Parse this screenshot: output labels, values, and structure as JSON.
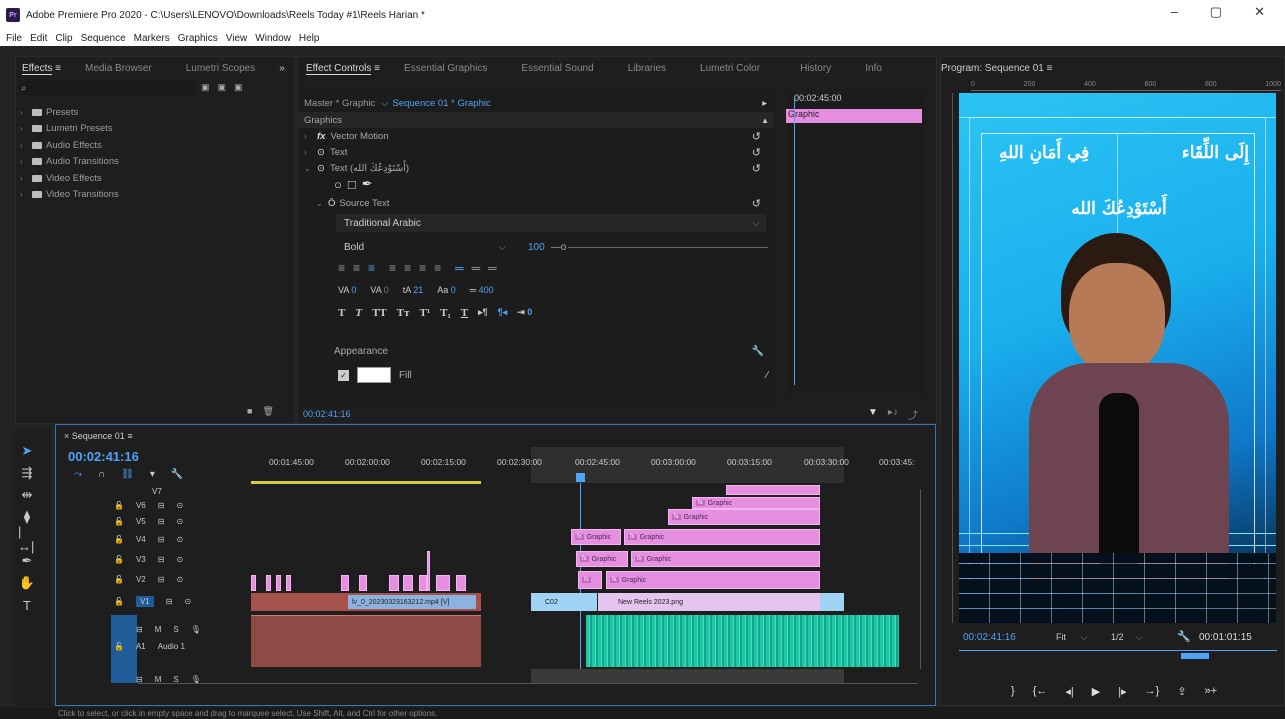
{
  "window": {
    "app_icon": "Pr",
    "title": "Adobe Premiere Pro 2020 - C:\\Users\\LENOVO\\Downloads\\Reels Today #1\\Reels Harian *",
    "controls": [
      "–",
      "▢",
      "✕"
    ]
  },
  "menu": [
    "File",
    "Edit",
    "Clip",
    "Sequence",
    "Markers",
    "Graphics",
    "View",
    "Window",
    "Help"
  ],
  "effects_panel": {
    "tabs": [
      "Effects",
      "Media Browser",
      "Lumetri Scopes"
    ],
    "active_menu": "≡",
    "more": "»",
    "search_placeholder": "",
    "items": [
      "Presets",
      "Lumetri Presets",
      "Audio Effects",
      "Audio Transitions",
      "Video Effects",
      "Video Transitions"
    ]
  },
  "effect_controls": {
    "tabs": [
      "Effect Controls",
      "Essential Graphics",
      "Essential Sound",
      "Libraries",
      "Lumetri Color",
      "History",
      "Info"
    ],
    "master": "Master * Graphic",
    "sequence": "Sequence 01 * Graphic",
    "timecode_top": "00:02:45:00",
    "clip_label": "Graphic",
    "section": "Graphics",
    "rows": [
      "Vector Motion",
      "Text",
      "Text (أَسْتَوْدِعُكَ الله)"
    ],
    "source_text": "Source Text",
    "font": "Traditional Arabic",
    "style": "Bold",
    "size": "100",
    "tracking_vals": {
      "kerning": "0",
      "tracking": "0",
      "leading": "21",
      "baseline": "0",
      "tsume": "400",
      "indent": "0"
    },
    "appearance": "Appearance",
    "fill": "Fill",
    "bottom_timecode": "00:02:41:16"
  },
  "program_monitor": {
    "title": "Program: Sequence 01",
    "ruler": [
      "0",
      "200",
      "400",
      "600",
      "800",
      "1000"
    ],
    "text_line1a": "إِلَى اللِّقَاء",
    "text_line1b": "فِي أَمَانِ اللهِ",
    "text_line2": "أَسْتَوْدِعُكَ الله",
    "timecode": "00:02:41:16",
    "fit": "Fit",
    "resolution": "1/2",
    "duration": "00:01:01:15"
  },
  "timeline": {
    "sequence": "Sequence 01",
    "timecode": "00:02:41:16",
    "ruler": [
      "00:01:45:00",
      "00:02:00:00",
      "00:02:15:00",
      "00:02:30:00",
      "00:02:45:00",
      "00:03:00:00",
      "00:03:15:00",
      "00:03:30:00",
      "00:03:45:"
    ],
    "tracks": [
      "V7",
      "V6",
      "V5",
      "V4",
      "V3",
      "V2",
      "V1",
      "A1"
    ],
    "audio_name": "Audio 1",
    "clip_mp4": "lv_0_20230323163212.mp4 [V]",
    "clip_c02": "C02",
    "clip_png": "New Reels 2023.png",
    "graphic": "Graphic",
    "fx": "fx"
  },
  "status": "Click to select, or click in empty space and drag to marquee select. Use Shift, Alt, and Ctrl for other options."
}
